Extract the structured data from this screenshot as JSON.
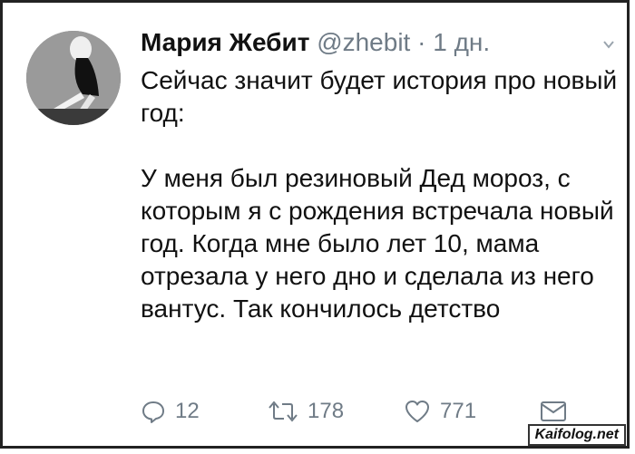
{
  "tweet": {
    "author_name": "Мария Жебит",
    "handle": "@zhebit",
    "separator": "·",
    "time": "1 дн.",
    "paragraphs": [
      "Сейчас значит будет история про новый год:",
      "У меня был резиновый Дед мороз, с которым я с рождения встречала новый год. Когда мне было лет 10, мама отрезала у него дно и сделала из него вантус. Так кончилось детство"
    ]
  },
  "actions": {
    "reply_count": "12",
    "retweet_count": "178",
    "like_count": "771"
  },
  "icons": {
    "avatar": "profile-photo",
    "menu": "chevron-down-icon",
    "reply": "reply-icon",
    "retweet": "retweet-icon",
    "like": "heart-icon",
    "message": "envelope-icon"
  },
  "watermark": "Kaifolog.net",
  "colors": {
    "text": "#111111",
    "muted": "#6f7b86"
  }
}
